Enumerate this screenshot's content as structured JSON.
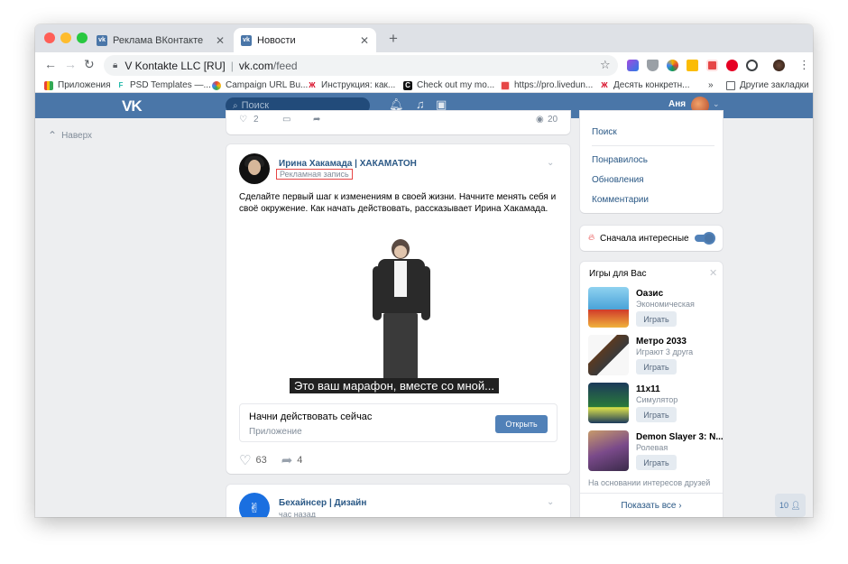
{
  "browser": {
    "tabs": [
      {
        "label": "Реклама ВКонтакте",
        "active": false
      },
      {
        "label": "Новости",
        "active": true
      }
    ],
    "url": {
      "org": "V Kontakte LLC [RU]",
      "host": "vk.com",
      "path": "/feed"
    },
    "bookmarks": [
      {
        "label": "Приложения",
        "icon": "apps-grid-icon"
      },
      {
        "label": "PSD Templates —...",
        "icon": "f-logo-icon"
      },
      {
        "label": "Campaign URL Bu...",
        "icon": "google-icon"
      },
      {
        "label": "Инструкция: как...",
        "icon": "hh-icon"
      },
      {
        "label": "Check out my mo...",
        "icon": "c-logo-icon"
      },
      {
        "label": "https://pro.livedun...",
        "icon": "livedune-icon"
      },
      {
        "label": "Десять конкретн...",
        "icon": "hh-icon"
      },
      {
        "label": "Другие закладки",
        "icon": "folder-icon"
      }
    ],
    "bookmarks_more": "»"
  },
  "vk": {
    "logo": "VK",
    "search_placeholder": "Поиск",
    "user_name": "Аня",
    "back_to_top": "Наверх"
  },
  "prev_post": {
    "likes": "2",
    "views": "20"
  },
  "post": {
    "author": "Ирина Хакамада | ХАКАМАТОН",
    "ad_label": "Рекламная запись",
    "text": "Сделайте первый шаг к изменениям в своей жизни. Начните менять себя и своё окружение. Как начать действовать, рассказывает Ирина Хакамада.",
    "video_subtitle": "Это ваш марафон, вместе со мной...",
    "cta_title": "Начни действовать сейчас",
    "cta_subtitle": "Приложение",
    "cta_button": "Открыть",
    "likes": "63",
    "shares": "4"
  },
  "next_post": {
    "author": "Бехайнсер | Дизайн",
    "time": "час назад"
  },
  "right_nav": {
    "items": [
      "Поиск",
      "Понравилось",
      "Обновления",
      "Комментарии"
    ]
  },
  "sort": {
    "label": "Сначала интересные",
    "enabled": true
  },
  "games": {
    "title": "Игры для Вас",
    "items": [
      {
        "name": "Оазис",
        "sub": "Экономическая",
        "button": "Играть"
      },
      {
        "name": "Метро 2033",
        "sub": "Играют 3 друга",
        "button": "Играть"
      },
      {
        "name": "11x11",
        "sub": "Симулятор",
        "button": "Играть"
      },
      {
        "name": "Demon Slayer 3: N...",
        "sub": "Ролевая",
        "button": "Играть"
      }
    ],
    "note": "На основании интересов друзей",
    "show_all": "Показать все ›"
  },
  "online_count": "10",
  "colors": {
    "vk_blue": "#4a76a8",
    "link": "#2a5885",
    "button": "#5181b8"
  }
}
